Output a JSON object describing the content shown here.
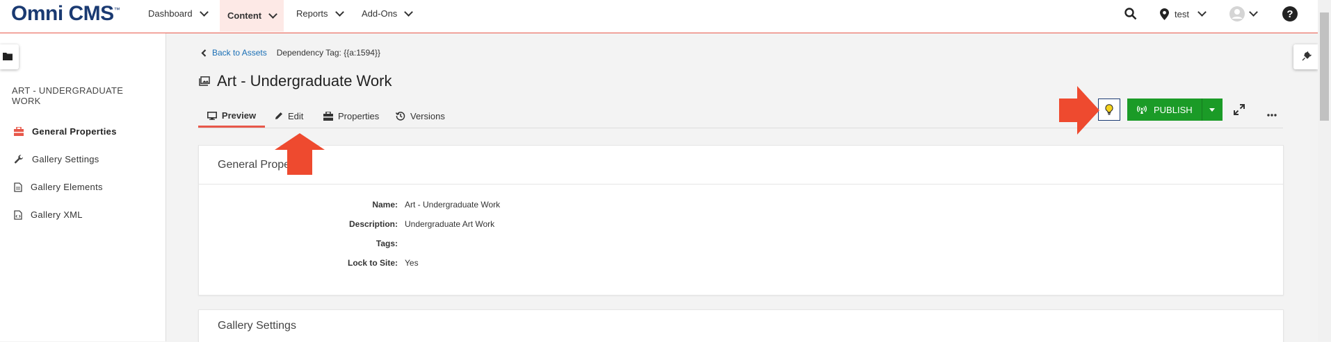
{
  "app": {
    "logo": "Omni CMS",
    "trademark": "™"
  },
  "nav": {
    "items": [
      {
        "label": "Dashboard",
        "active": false
      },
      {
        "label": "Content",
        "active": true
      },
      {
        "label": "Reports",
        "active": false
      },
      {
        "label": "Add-Ons",
        "active": false
      }
    ],
    "site_label": "test"
  },
  "sidebar": {
    "title": "ART - UNDERGRADUATE WORK",
    "items": [
      {
        "label": "General Properties",
        "icon": "toolbox-icon",
        "active": true
      },
      {
        "label": "Gallery Settings",
        "icon": "wrench-icon",
        "active": false
      },
      {
        "label": "Gallery Elements",
        "icon": "document-icon",
        "active": false
      },
      {
        "label": "Gallery XML",
        "icon": "xml-file-icon",
        "active": false
      }
    ]
  },
  "breadcrumb": {
    "back_label": "Back to Assets",
    "dependency_tag": "Dependency Tag: {{a:1594}}"
  },
  "page": {
    "title": "Art - Undergraduate Work"
  },
  "tabs": [
    {
      "label": "Preview",
      "active": true
    },
    {
      "label": "Edit",
      "active": false
    },
    {
      "label": "Properties",
      "active": false
    },
    {
      "label": "Versions",
      "active": false
    }
  ],
  "actions": {
    "publish_label": "PUBLISH"
  },
  "general_card": {
    "title": "General Properties",
    "rows": [
      {
        "label": "Name:",
        "value": "Art - Undergraduate Work"
      },
      {
        "label": "Description:",
        "value": "Undergraduate Art Work"
      },
      {
        "label": "Tags:",
        "value": ""
      },
      {
        "label": "Lock to Site:",
        "value": "Yes"
      }
    ]
  },
  "gallery_card": {
    "title": "Gallery Settings"
  },
  "colors": {
    "accent": "#e8584a",
    "publish": "#1b9b27",
    "brand": "#1a3a72",
    "link": "#1a6fb5"
  }
}
